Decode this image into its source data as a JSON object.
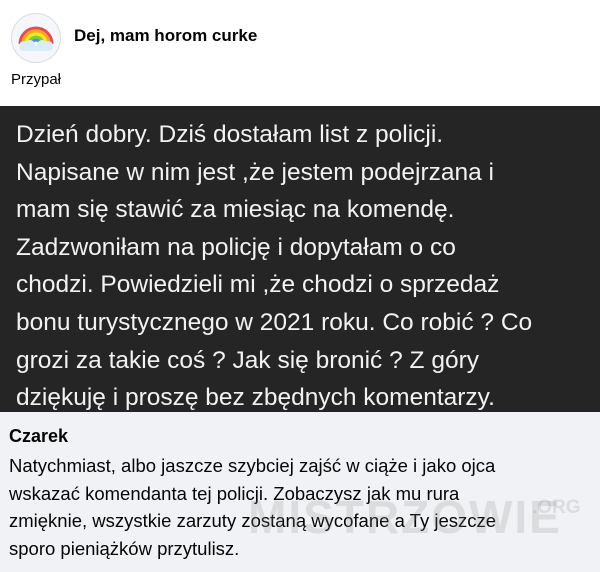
{
  "group": {
    "name": "Dej, mam horom curke",
    "avatar_icon": "rainbow-cloud-icon"
  },
  "post": {
    "text": "Przypał"
  },
  "message": {
    "text": "Dzień dobry. Dziś dostałam list z policji.\nNapisane w nim jest ,że jestem podejrzana i\nmam się stawić za miesiąc na komendę.\nZadzwoniłam na policję i dopytałam o co\nchodzi. Powiedzieli mi ,że chodzi o sprzedaż\nbonu turystycznego w 2021 roku. Co robić ? Co\ngrozi za takie coś ? Jak się bronić ? Z góry\ndziękuję i proszę bez zbędnych komentarzy."
  },
  "comment": {
    "author": "Czarek",
    "text": "Natychmiast, albo jaszcze szybciej zajść w ciąże i jako ojca\nwskazać komendanta tej policji. Zobaczysz jak mu rura\nzmięknie, wszystkie zarzuty zostaną wycofane a Ty jeszcze\nsporo pieniążków przytulisz."
  },
  "watermark": {
    "text": "MISTRZOWIE",
    "suffix": ".ORG"
  },
  "colors": {
    "message_bg": "#252525",
    "comment_bg": "#f0f2f5",
    "text": "#050505"
  }
}
